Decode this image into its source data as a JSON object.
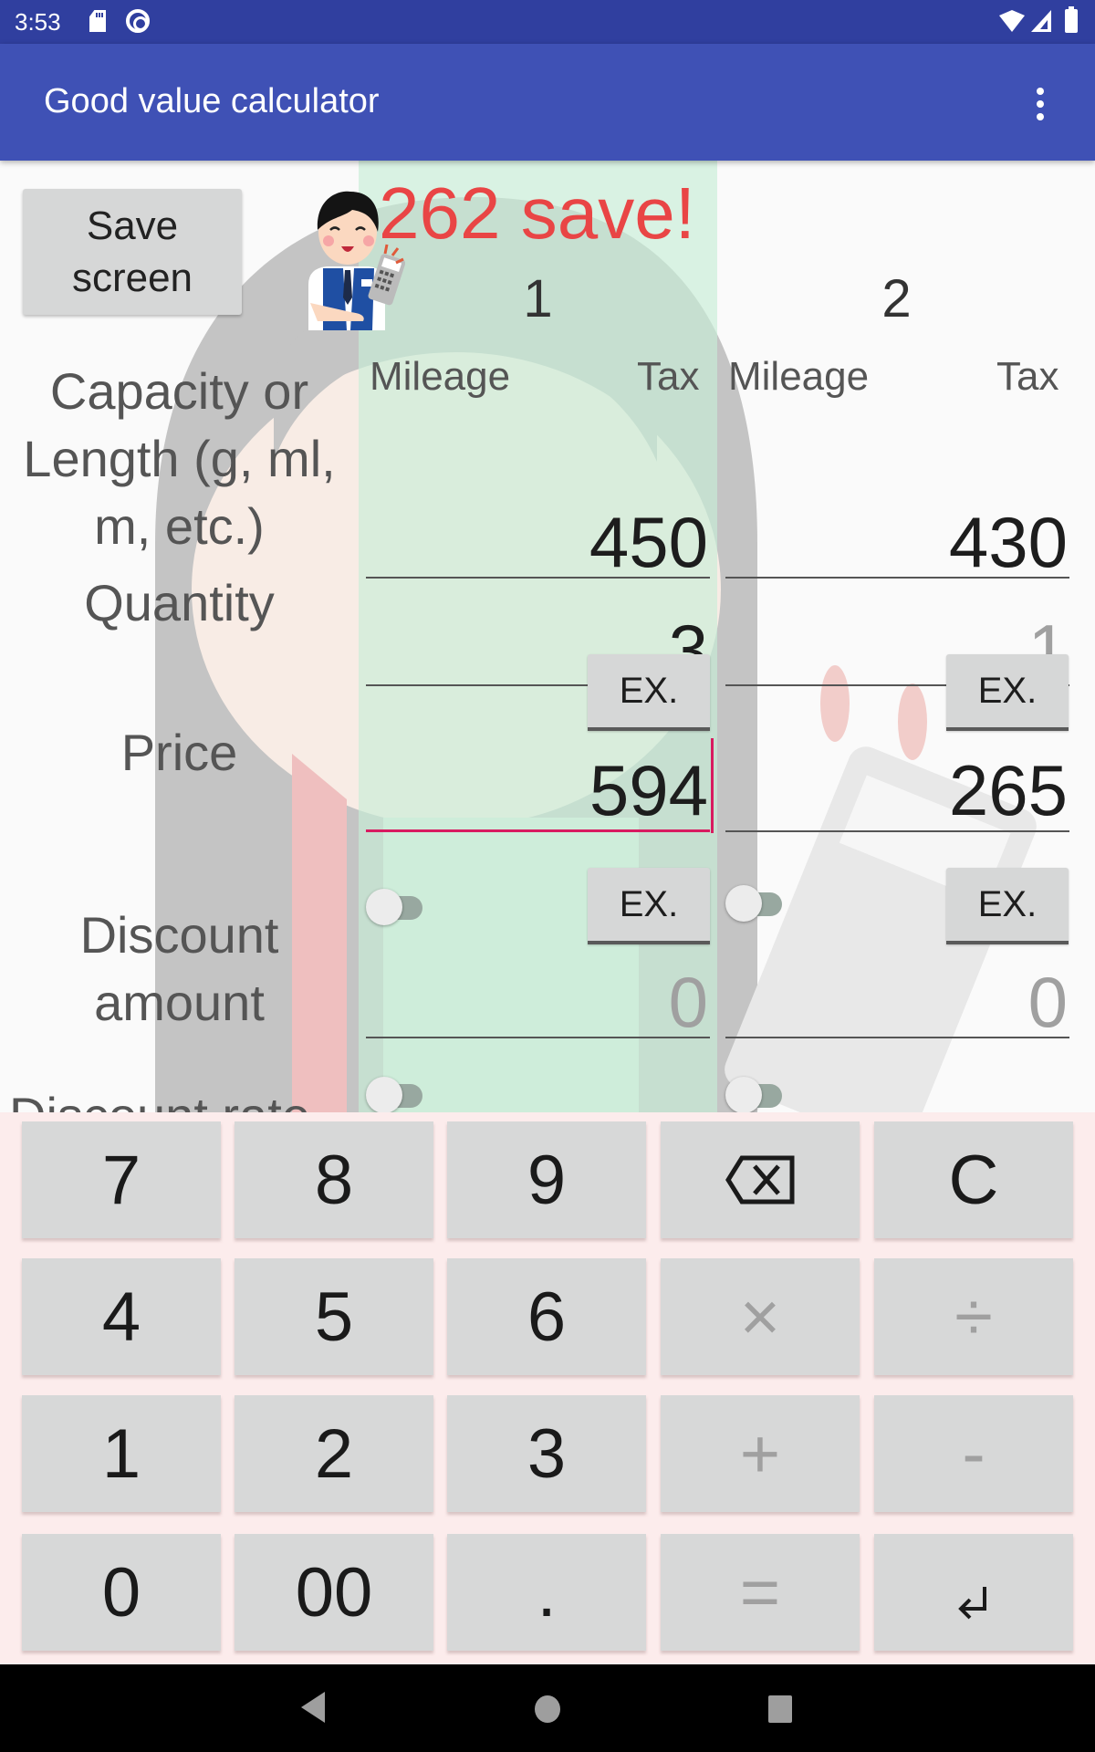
{
  "status_bar": {
    "time": "3:53",
    "left_icons": [
      "sd-card-icon",
      "q-data-saver-icon"
    ],
    "right_icons": [
      "wifi-icon",
      "cellular-signal-icon",
      "battery-icon"
    ]
  },
  "app_bar": {
    "title": "Good value calculator",
    "overflow_icon": "more-vert-icon"
  },
  "header": {
    "save_screen_label": "Save\nscreen",
    "savings_message": "262 save!",
    "mascot_icon": "clerk-with-calculator-icon"
  },
  "columns": [
    {
      "number": "1",
      "mileage_label": "Mileage",
      "tax_label": "Tax",
      "highlighted": true,
      "highlight_color": "#c8eed7"
    },
    {
      "number": "2",
      "mileage_label": "Mileage",
      "tax_label": "Tax",
      "highlighted": false
    }
  ],
  "rows": {
    "capacity": {
      "label": "Capacity or Length (g, ml, m, etc.)",
      "values": [
        "450",
        "430"
      ]
    },
    "quantity": {
      "label": "Quantity",
      "values": [
        "3",
        "1"
      ],
      "hint": [
        false,
        true
      ]
    },
    "price": {
      "label": "Price",
      "ex_label": "EX.",
      "values": [
        "594",
        "265"
      ],
      "focused_column": 1
    },
    "discount_amount": {
      "label": "Discount amount",
      "ex_label": "EX.",
      "switch_on": [
        false,
        false
      ],
      "values": [
        "0",
        "0"
      ],
      "hint": [
        true,
        true
      ]
    },
    "discount_rate": {
      "label": "Discount rate",
      "switch_on": [
        false,
        false
      ]
    }
  },
  "keypad": {
    "keys": [
      [
        "7",
        "8",
        "9",
        "⌫",
        "C"
      ],
      [
        "4",
        "5",
        "6",
        "×",
        "÷"
      ],
      [
        "1",
        "2",
        "3",
        "+",
        "-"
      ],
      [
        "0",
        "00",
        ".",
        "=",
        "↲"
      ]
    ],
    "key_names": [
      [
        "key-7",
        "key-8",
        "key-9",
        "backspace-key",
        "clear-key"
      ],
      [
        "key-4",
        "key-5",
        "key-6",
        "multiply-key",
        "divide-key"
      ],
      [
        "key-1",
        "key-2",
        "key-3",
        "plus-key",
        "minus-key"
      ],
      [
        "key-0",
        "key-00",
        "decimal-key",
        "equals-key",
        "enter-key"
      ]
    ],
    "disabled_keys": [
      "×",
      "÷",
      "+",
      "-",
      "="
    ],
    "background_color": "#fcecec"
  },
  "nav_bar": {
    "buttons": [
      "back-icon",
      "home-icon",
      "recents-icon"
    ]
  },
  "colors": {
    "status_bar": "#303f9f",
    "app_bar": "#3f51b5",
    "savings_text": "#e94545",
    "focus_accent": "#d81b60"
  }
}
